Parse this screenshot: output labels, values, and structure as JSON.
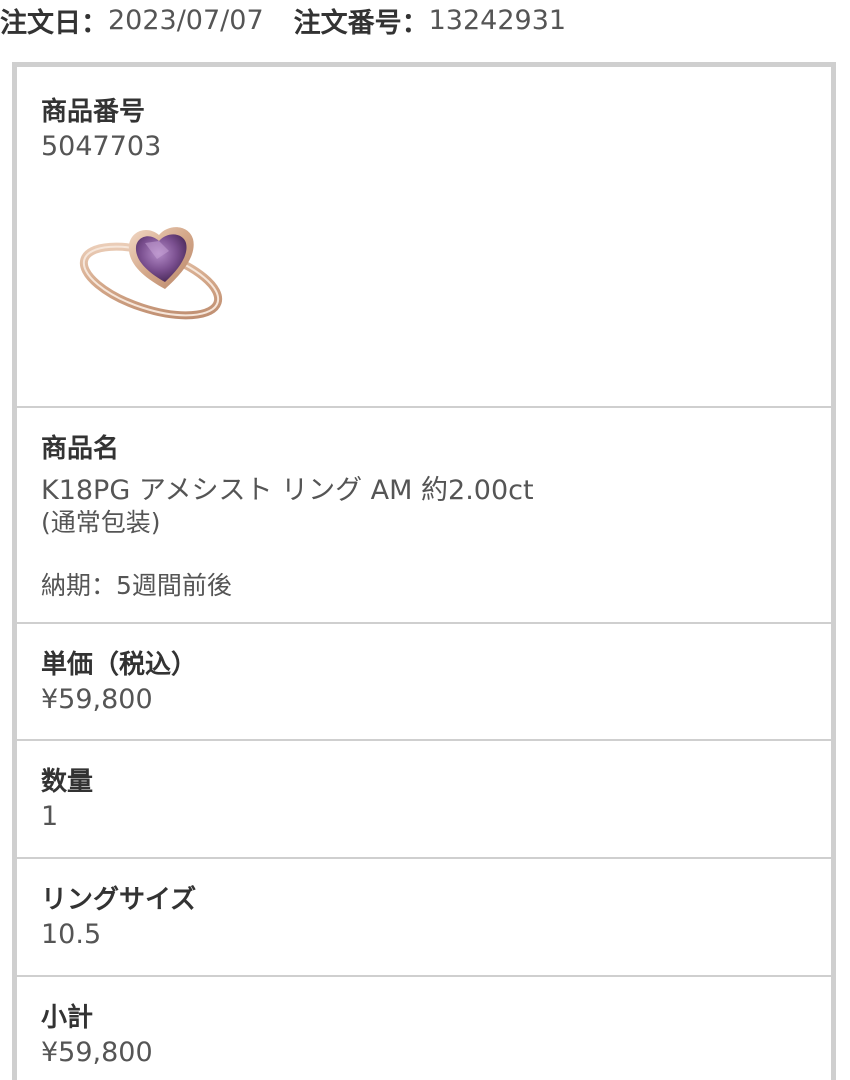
{
  "order": {
    "date_label": "注文日：",
    "date_value": "2023/07/07",
    "number_label": "注文番号：",
    "number_value": "13242931"
  },
  "item": {
    "product_code_label": "商品番号",
    "product_code": "5047703",
    "product_name_label": "商品名",
    "product_name": "K18PG アメシスト リング AM 約2.00ct",
    "packaging": "(通常包装)",
    "delivery": "納期：5週間前後",
    "unit_price_label": "単価（税込）",
    "unit_price": "¥59,800",
    "quantity_label": "数量",
    "quantity": "1",
    "ring_size_label": "リングサイズ",
    "ring_size": "10.5",
    "subtotal_label": "小計",
    "subtotal": "¥59,800"
  },
  "colors": {
    "border": "#cfcfcf",
    "text": "#333333",
    "value_text": "#555555",
    "gold": "#d9b49a",
    "amethyst": "#7a4f8f"
  }
}
